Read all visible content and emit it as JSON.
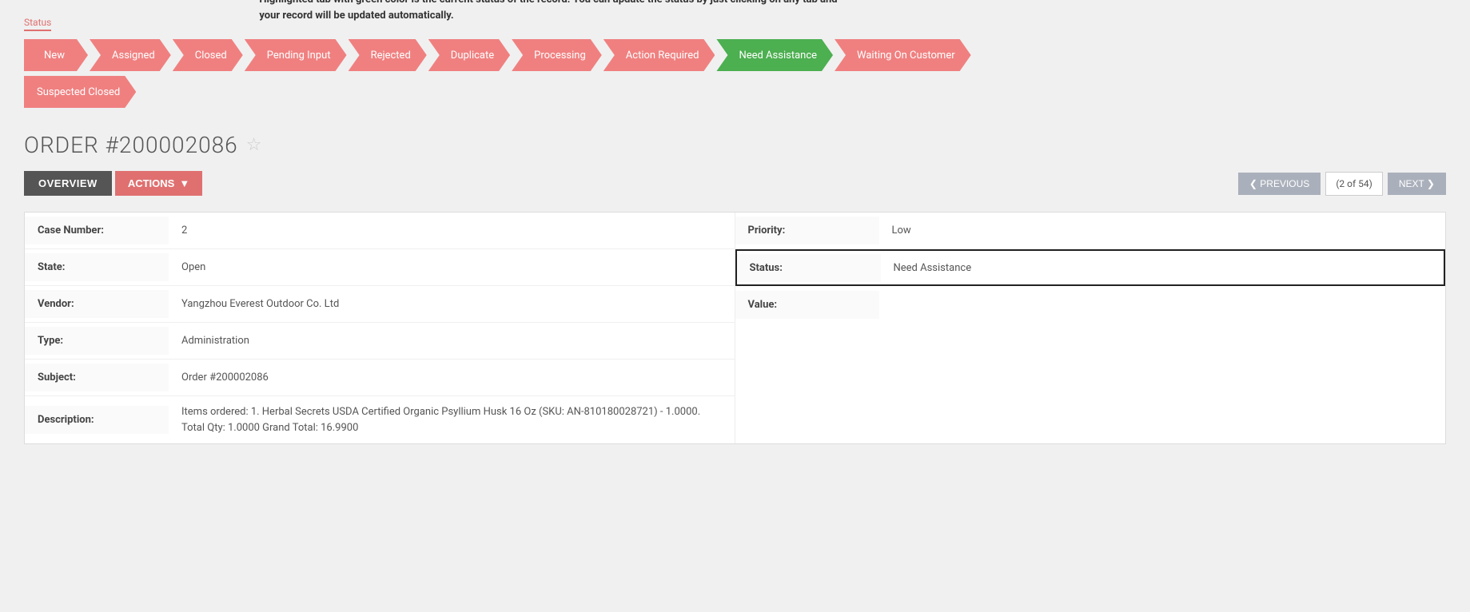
{
  "status_section": {
    "label": "Status",
    "tooltip": "Highlighted tab with green color is the current status of the record. You can update the status by just clicking on any tab and your record will be updated automatically.",
    "pipeline_row1": [
      {
        "id": "new",
        "label": "New",
        "active": false,
        "first": true
      },
      {
        "id": "assigned",
        "label": "Assigned",
        "active": false,
        "first": false
      },
      {
        "id": "closed",
        "label": "Closed",
        "active": false,
        "first": false
      },
      {
        "id": "pending-input",
        "label": "Pending Input",
        "active": false,
        "first": false
      },
      {
        "id": "rejected",
        "label": "Rejected",
        "active": false,
        "first": false
      },
      {
        "id": "duplicate",
        "label": "Duplicate",
        "active": false,
        "first": false
      },
      {
        "id": "processing",
        "label": "Processing",
        "active": false,
        "first": false
      },
      {
        "id": "action-required",
        "label": "Action Required",
        "active": false,
        "first": false
      },
      {
        "id": "need-assistance",
        "label": "Need Assistance",
        "active": true,
        "first": false
      },
      {
        "id": "waiting-on-customer",
        "label": "Waiting On Customer",
        "active": false,
        "first": false
      }
    ],
    "pipeline_row2": [
      {
        "id": "suspected-closed",
        "label": "Suspected Closed",
        "active": false,
        "first": true
      }
    ]
  },
  "order": {
    "title": "ORDER #200002086",
    "star_icon": "☆",
    "overview_label": "OVERVIEW",
    "actions_label": "ACTIONS",
    "actions_chevron": "▼",
    "pagination": {
      "prev_label": "❮ PREVIOUS",
      "next_label": "NEXT ❯",
      "page_info": "(2 of 54)"
    }
  },
  "record": {
    "left_fields": [
      {
        "label": "Case Number:",
        "value": "2"
      },
      {
        "label": "State:",
        "value": "Open"
      },
      {
        "label": "Vendor:",
        "value": "Yangzhou Everest Outdoor Co. Ltd"
      },
      {
        "label": "Type:",
        "value": "Administration"
      },
      {
        "label": "Subject:",
        "value": "Order #200002086"
      },
      {
        "label": "Description:",
        "value": "Items ordered: 1. Herbal Secrets USDA Certified Organic Psyllium Husk 16 Oz (SKU: AN-810180028721) - 1.0000. Total Qty: 1.0000 Grand Total: 16.9900"
      }
    ],
    "right_fields": [
      {
        "label": "Priority:",
        "value": "Low",
        "highlighted": false
      },
      {
        "label": "Status:",
        "value": "Need Assistance",
        "highlighted": true
      },
      {
        "label": "Value:",
        "value": "",
        "highlighted": false
      }
    ]
  }
}
